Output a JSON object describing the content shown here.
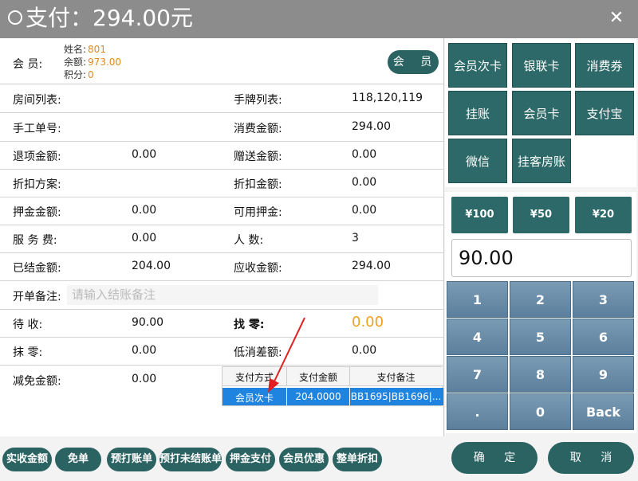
{
  "title": "支付：294.00元",
  "member": {
    "label": "会 员:",
    "info": [
      {
        "k": "姓名:",
        "v": "801"
      },
      {
        "k": "余额:",
        "v": "973.00"
      },
      {
        "k": "积分:",
        "v": "0"
      }
    ],
    "button": "会 员"
  },
  "rows": [
    {
      "l1": "房间列表:",
      "v1": "",
      "l2": "手牌列表:",
      "v2": "118,120,119"
    },
    {
      "l1": "手工单号:",
      "v1": "",
      "l2": "消费金额:",
      "v2": "294.00"
    },
    {
      "l1": "退项金额:",
      "v1": "0.00",
      "l2": "赠送金额:",
      "v2": "0.00"
    },
    {
      "l1": "折扣方案:",
      "v1": "",
      "l2": "折扣金额:",
      "v2": "0.00"
    },
    {
      "l1": "押金金额:",
      "v1": "0.00",
      "l2": "可用押金:",
      "v2": "0.00"
    },
    {
      "l1": "服 务 费:",
      "v1": "0.00",
      "l2": "人     数:",
      "v2": "3"
    },
    {
      "l1": "已结金额:",
      "v1": "204.00",
      "l2": "应收金额:",
      "v2": "294.00"
    }
  ],
  "note": {
    "label": "开单备注:",
    "placeholder": "请输入结账备注"
  },
  "rows2": [
    {
      "l1": "待 收:",
      "v1": "90.00",
      "l2": "找 零:",
      "v2": "0.00"
    },
    {
      "l1": "抹 零:",
      "v1": "0.00",
      "l2": "低消差额:",
      "v2": "0.00"
    },
    {
      "l1": "减免金额:",
      "v1": "0.00"
    }
  ],
  "pay_table": {
    "headers": [
      "支付方式",
      "支付金额",
      "支付备注"
    ],
    "rows": [
      [
        "会员次卡",
        "204.0000",
        "BB1695|BB1696|..."
      ]
    ]
  },
  "bottom_buttons": [
    "实收金额",
    "免单",
    "预打账单",
    "预打未结账单",
    "押金支付",
    "会员优惠",
    "整单折扣"
  ],
  "pay_methods": [
    "会员次卡",
    "银联卡",
    "消费券",
    "挂账",
    "会员卡",
    "支付宝",
    "微信",
    "挂客房账"
  ],
  "quick_amounts": [
    "¥100",
    "¥50",
    "¥20"
  ],
  "amount_value": "90.00",
  "keys": [
    "1",
    "2",
    "3",
    "4",
    "5",
    "6",
    "7",
    "8",
    "9",
    ".",
    "0",
    "Back"
  ],
  "confirm": "确 定",
  "cancel": "取 消"
}
